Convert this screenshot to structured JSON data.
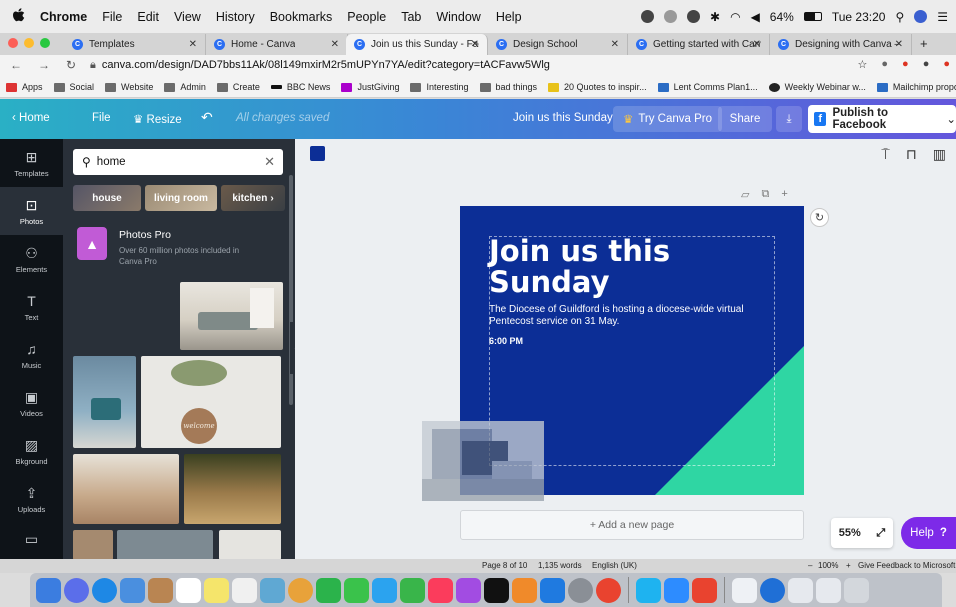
{
  "menubar": {
    "app": "Chrome",
    "items": [
      "File",
      "Edit",
      "View",
      "History",
      "Bookmarks",
      "People",
      "Tab",
      "Window",
      "Help"
    ],
    "battery": "64%",
    "clock": "Tue 23:20"
  },
  "tabs": [
    {
      "label": "Templates",
      "active": false
    },
    {
      "label": "Home - Canva",
      "active": false
    },
    {
      "label": "Join us this Sunday - Facel",
      "active": true
    },
    {
      "label": "Design School",
      "active": false
    },
    {
      "label": "Getting started with Canva",
      "active": false
    },
    {
      "label": "Designing with Canva – De",
      "active": false
    }
  ],
  "address": {
    "url": "canva.com/design/DAD7bbs11Ak/08l149mxirM2r5mUPYn7YA/edit?category=tACFavw5Wlg"
  },
  "bookmarks": [
    "Apps",
    "Social",
    "Website",
    "Admin",
    "Create",
    "BBC News",
    "JustGiving",
    "Interesting",
    "bad things",
    "20 Quotes to inspir...",
    "Lent Comms Plan1...",
    "Weekly Webinar w...",
    "Mailchimp proposal..."
  ],
  "canva_header": {
    "home": "Home",
    "file": "File",
    "resize": "Resize",
    "saved": "All changes saved",
    "doc_title": "Join us this Sunday",
    "try_pro": "Try Canva Pro",
    "share": "Share",
    "publish": "Publish to Facebook"
  },
  "rail": [
    "Templates",
    "Photos",
    "Elements",
    "Text",
    "Music",
    "Videos",
    "Bkground",
    "Uploads"
  ],
  "panel": {
    "search_value": "home",
    "chips": [
      "house",
      "living room",
      "kitchen"
    ],
    "photos_pro_title": "Photos Pro",
    "photos_pro_desc": "Over 60 million photos included in Canva Pro",
    "welcome_sign": "welcome"
  },
  "design": {
    "title": "Join us this Sunday",
    "subtitle": "The Diocese of Guildford is hosting a diocese-wide virtual Pentecost service on 31 May.",
    "time": "6:00 PM",
    "bg_color": "#0c2e96",
    "accent_color": "#2fd6a3"
  },
  "canvas": {
    "add_page": "+ Add a new page",
    "zoom": "55%",
    "help": "Help"
  },
  "statusbar": {
    "page": "Page 8 of 10",
    "words": "1,135 words",
    "lang": "English (UK)",
    "zoom": "100%",
    "feedback": "Give Feedback to Microsoft"
  }
}
